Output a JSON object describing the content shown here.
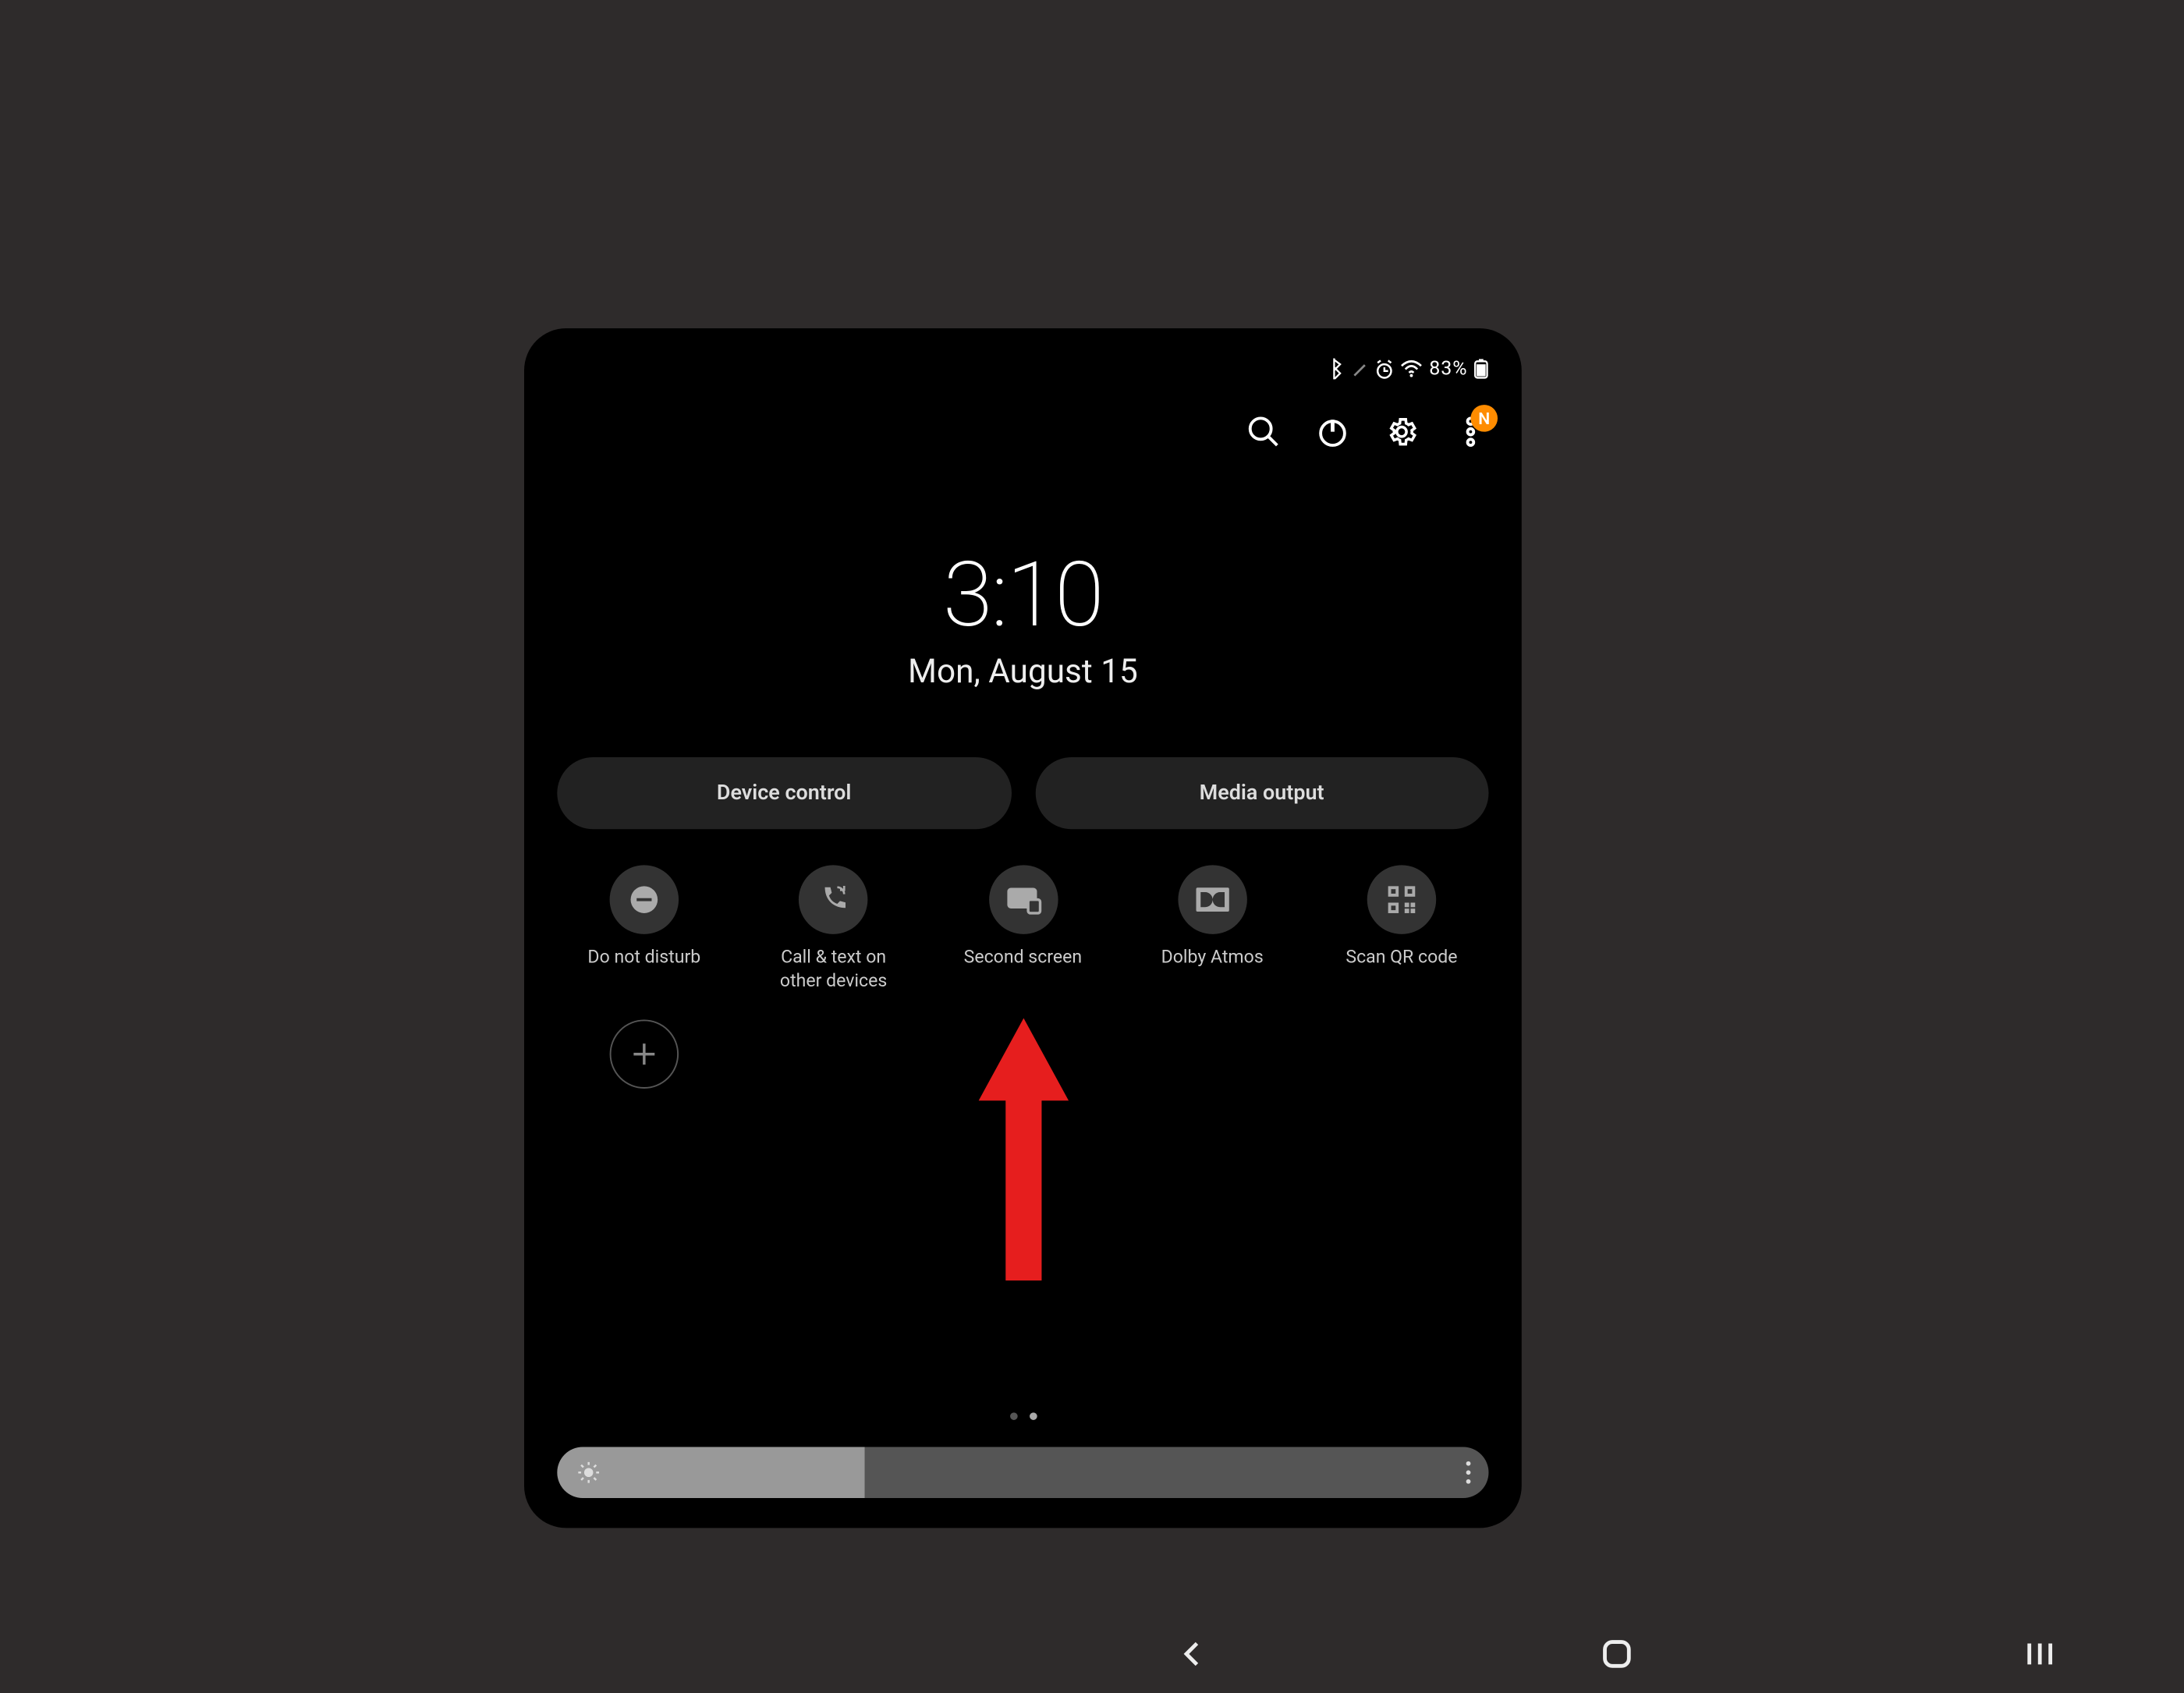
{
  "status": {
    "battery_pct": "83%",
    "badge_letter": "N"
  },
  "clock": {
    "time": "3:10",
    "date": "Mon, August 15"
  },
  "pills": {
    "device_control": "Device control",
    "media_output": "Media output"
  },
  "qs": [
    {
      "id": "dnd",
      "label": "Do not disturb"
    },
    {
      "id": "call-text",
      "label": "Call & text on other devices"
    },
    {
      "id": "second-screen",
      "label": "Second screen"
    },
    {
      "id": "dolby",
      "label": "Dolby Atmos"
    },
    {
      "id": "scan-qr",
      "label": "Scan QR code"
    }
  ],
  "brightness": {
    "percent": 33
  }
}
